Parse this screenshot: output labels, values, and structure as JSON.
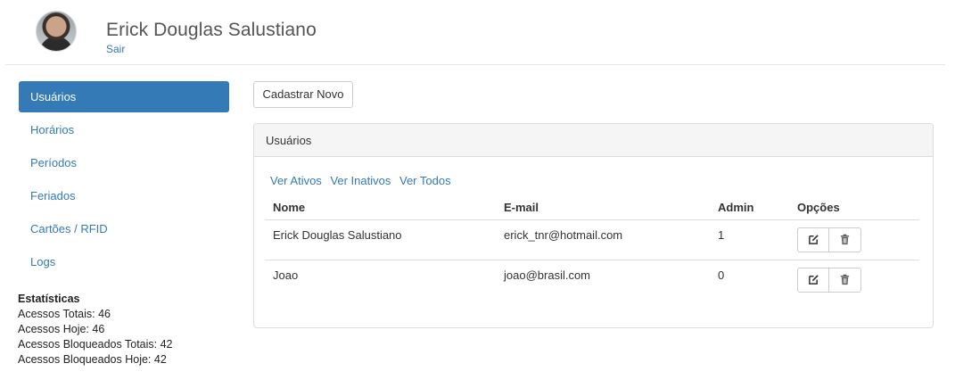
{
  "header": {
    "user_name": "Erick Douglas Salustiano",
    "logout_label": "Sair"
  },
  "sidebar": {
    "items": [
      {
        "label": "Usuários",
        "active": true
      },
      {
        "label": "Horários",
        "active": false
      },
      {
        "label": "Períodos",
        "active": false
      },
      {
        "label": "Feriados",
        "active": false
      },
      {
        "label": "Cartões / RFID",
        "active": false
      },
      {
        "label": "Logs",
        "active": false
      }
    ],
    "stats": {
      "title": "Estatísticas",
      "lines": [
        "Acessos Totais: 46",
        "Acessos Hoje: 46",
        "Acessos Bloqueados Totais: 42",
        "Acessos Bloqueados Hoje: 42"
      ]
    }
  },
  "main": {
    "new_button_label": "Cadastrar Novo",
    "panel_title": "Usuários",
    "filters": [
      "Ver Ativos",
      "Ver Inativos",
      "Ver Todos"
    ],
    "table": {
      "headers": [
        "Nome",
        "E-mail",
        "Admin",
        "Opções"
      ],
      "rows": [
        {
          "name": "Erick Douglas Salustiano",
          "email": "erick_tnr@hotmail.com",
          "admin": "1"
        },
        {
          "name": "Joao",
          "email": "joao@brasil.com",
          "admin": "0"
        }
      ]
    },
    "row_actions": [
      {
        "icon": "edit-icon"
      },
      {
        "icon": "trash-icon"
      }
    ]
  },
  "colors": {
    "accent": "#337ab7",
    "panel_heading_bg": "#f5f5f5",
    "border": "#dddddd"
  }
}
